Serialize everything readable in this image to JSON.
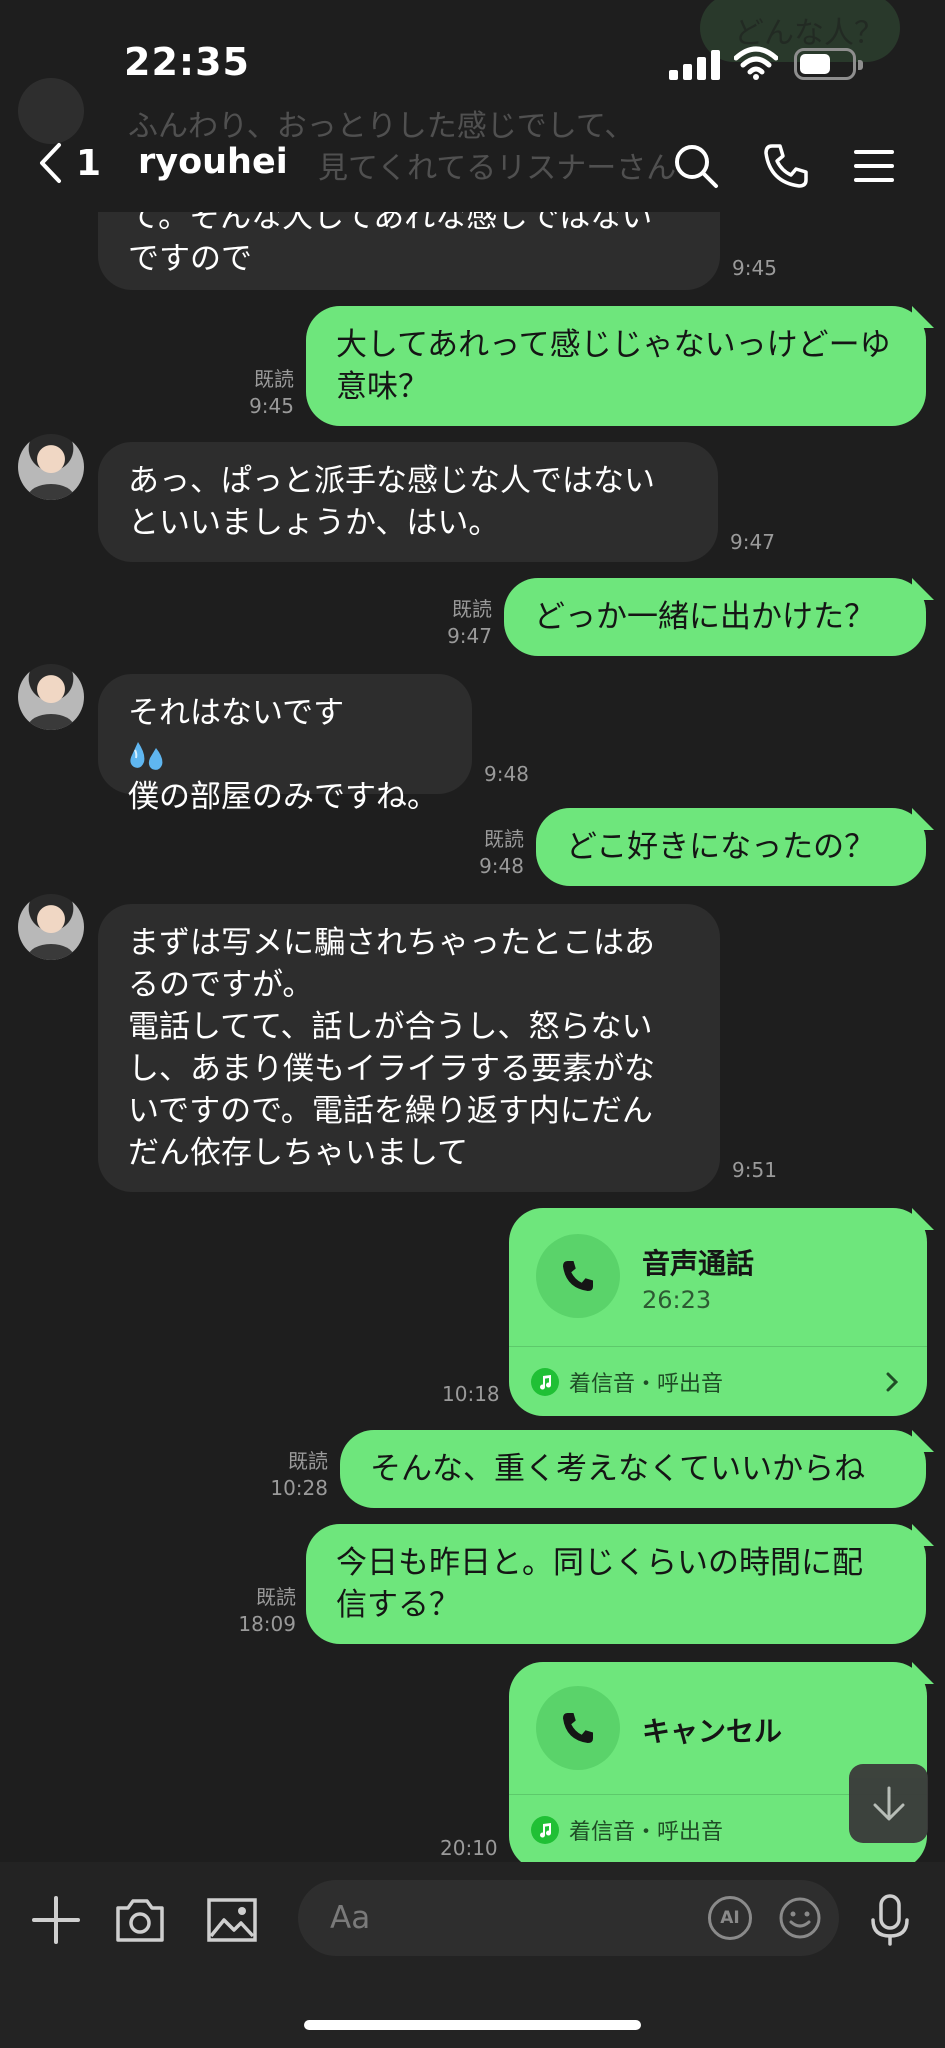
{
  "status_bar": {
    "time": "22:35"
  },
  "ghost": {
    "text_line1": "ふんわり、おっとりした感じでして、",
    "text_line2": "見てくれてるリスナーさん",
    "right_bubble": "どんな人？"
  },
  "header": {
    "back_count": "1",
    "name": "ryouhei"
  },
  "messages": {
    "m1": {
      "text": "て。そんな大してあれな感じではない\nですので",
      "time": "9:45"
    },
    "m2": {
      "text": "大してあれって感じじゃないっけどーゆ意味？",
      "read": "既読",
      "time": "9:45"
    },
    "m3": {
      "text": "あっ、ぱっと派手な感じな人ではない\nといいましょうか、はい。",
      "time": "9:47"
    },
    "m4": {
      "text": "どっか一緒に出かけた？",
      "read": "既読",
      "time": "9:47"
    },
    "m5": {
      "line1": "それはないです",
      "line2": "僕の部屋のみですね。",
      "emoji": "sweat-drops",
      "time": "9:48"
    },
    "m6": {
      "text": "どこ好きになったの？",
      "read": "既読",
      "time": "9:48"
    },
    "m7": {
      "text": "まずは写メに騙されちゃったとこはあ\nるのですが。\n電話してて、話しが合うし、怒らない\nし、あまり僕もイライラする要素がな\nいですので。電話を繰り返す内にだん\nだん依存しちゃいまして",
      "time": "9:51"
    },
    "m8": {
      "title": "音声通話",
      "duration": "26:23",
      "ringtone": "着信音・呼出音",
      "time": "10:18"
    },
    "m9": {
      "text": "そんな、重く考えなくていいからね",
      "read": "既読",
      "time": "10:28"
    },
    "m10": {
      "text": "今日も昨日と。同じくらいの時間に配\n信する？",
      "read": "既読",
      "time": "18:09"
    },
    "m11": {
      "title": "キャンセル",
      "ringtone": "着信音・呼出音",
      "time": "20:10"
    }
  },
  "input": {
    "placeholder": "Aa",
    "ai_label": "AI"
  },
  "colors": {
    "background": "#1e1e1e",
    "incoming_bubble": "#2d2d2d",
    "outgoing_bubble": "#6ee67c",
    "meta_text": "#9a9a9a"
  }
}
